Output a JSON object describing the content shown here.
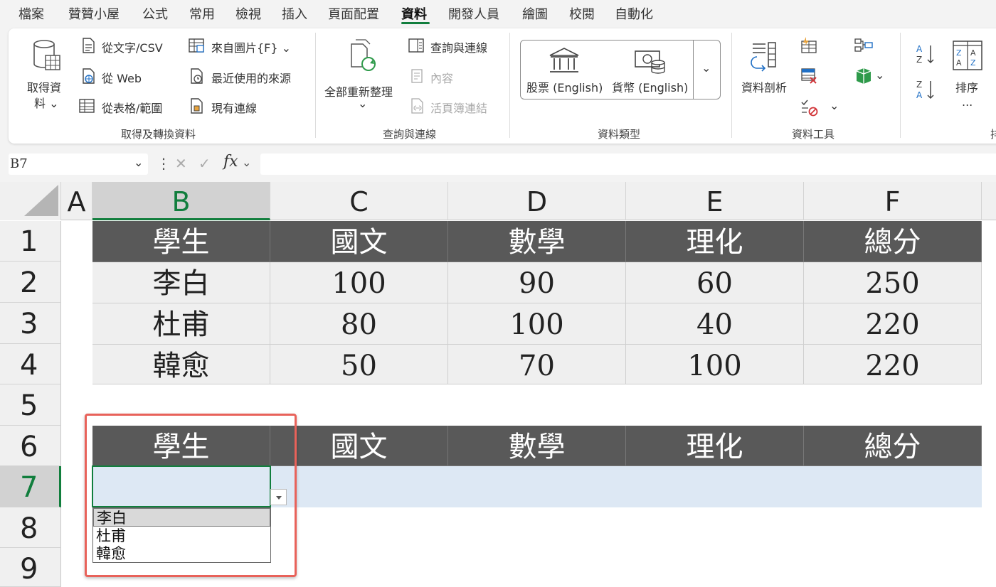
{
  "menu_tabs": [
    {
      "label": "檔案"
    },
    {
      "label": "贊贊小屋"
    },
    {
      "label": "公式"
    },
    {
      "label": "常用"
    },
    {
      "label": "檢視"
    },
    {
      "label": "插入"
    },
    {
      "label": "頁面配置"
    },
    {
      "label": "資料",
      "active": true
    },
    {
      "label": "開發人員"
    },
    {
      "label": "繪圖"
    },
    {
      "label": "校閱"
    },
    {
      "label": "自動化"
    }
  ],
  "ribbon": {
    "get_transform": {
      "get_data_line1": "取得資",
      "get_data_line2": "料 ⌄",
      "from_text_csv": "從文字/CSV",
      "from_web": "從 Web",
      "from_table": "從表格/範圍",
      "from_picture": "來自圖片{F} ⌄",
      "recent_sources": "最近使用的來源",
      "existing_connections": "現有連線",
      "title": "取得及轉換資料"
    },
    "queries": {
      "refresh_all": "全部重新整理",
      "refresh_chevron": "⌄",
      "queries_connections": "查詢與連線",
      "properties": "內容",
      "edit_links": "活頁簿連結",
      "title": "查詢與連線"
    },
    "data_types": {
      "stocks": "股票 (English)",
      "currencies": "貨幣 (English)",
      "chevron": "⌄",
      "title": "資料類型"
    },
    "data_tools": {
      "text_to_columns": "資料剖析",
      "title": "資料工具"
    },
    "sort": {
      "sort_label": "排序",
      "sort_more": "...",
      "title_partial": "排"
    },
    "accent_color": "#117e3d"
  },
  "formula_bar": {
    "name_box": "B7",
    "fx": "fx",
    "formula": ""
  },
  "grid": {
    "columns": [
      "A",
      "B",
      "C",
      "D",
      "E",
      "F"
    ],
    "rows": [
      "1",
      "2",
      "3",
      "4",
      "5",
      "6",
      "7",
      "8",
      "9"
    ],
    "selected_column": "B",
    "selected_row": "7",
    "table1": {
      "header": [
        "學生",
        "國文",
        "數學",
        "理化",
        "總分"
      ],
      "rows": [
        [
          "李白",
          "100",
          "90",
          "60",
          "250"
        ],
        [
          "杜甫",
          "80",
          "100",
          "40",
          "220"
        ],
        [
          "韓愈",
          "50",
          "70",
          "100",
          "220"
        ]
      ]
    },
    "table2": {
      "header": [
        "學生",
        "國文",
        "數學",
        "理化",
        "總分"
      ]
    },
    "header_fill": "#595959",
    "body_fill": "#efefef",
    "input_row_fill": "#dde8f4"
  },
  "dropdown": {
    "options": [
      "李白",
      "杜甫",
      "韓愈"
    ],
    "highlighted": "李白"
  },
  "callout_color": "#e8625a"
}
